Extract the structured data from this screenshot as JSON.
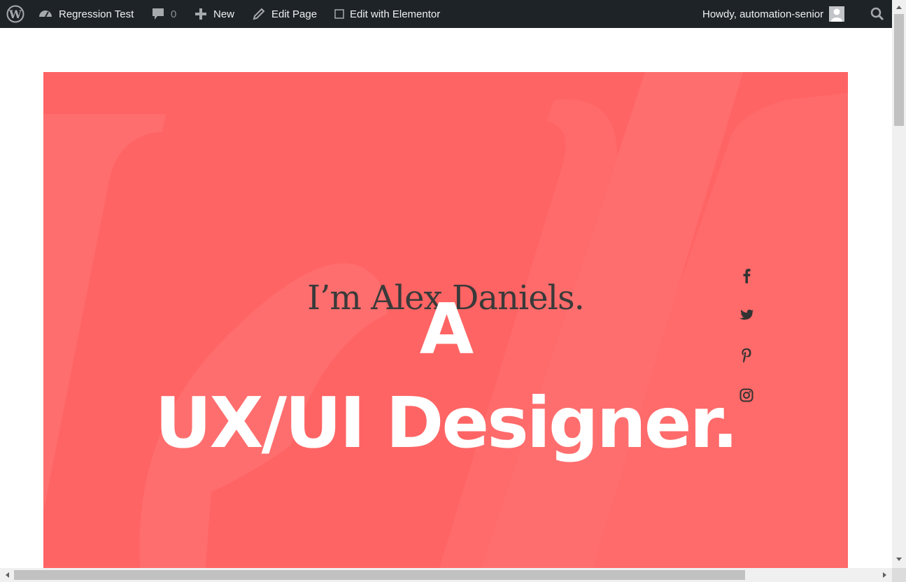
{
  "adminbar": {
    "site_name": "Regression Test",
    "comments_count": "0",
    "new_label": "New",
    "edit_page_label": "Edit Page",
    "elementor_label": "Edit with Elementor",
    "howdy_label": "Howdy, automation-senior",
    "icons": [
      "wordpress-icon",
      "dashboard-icon",
      "comment-icon",
      "plus-icon",
      "pencil-icon",
      "checkbox-icon",
      "avatar",
      "search-icon"
    ]
  },
  "hero": {
    "intro": "I’m Alex Daniels.",
    "line1": "A",
    "line2": "UX/UI Designer.",
    "background_color": "#ff6464",
    "social_icons": [
      "facebook-icon",
      "twitter-icon",
      "pinterest-icon",
      "instagram-icon"
    ]
  },
  "colors": {
    "adminbar_bg": "#1d2327",
    "hero_bg": "#ff6464",
    "hero_text": "#ffffff",
    "intro_text": "#3a3a3a"
  }
}
